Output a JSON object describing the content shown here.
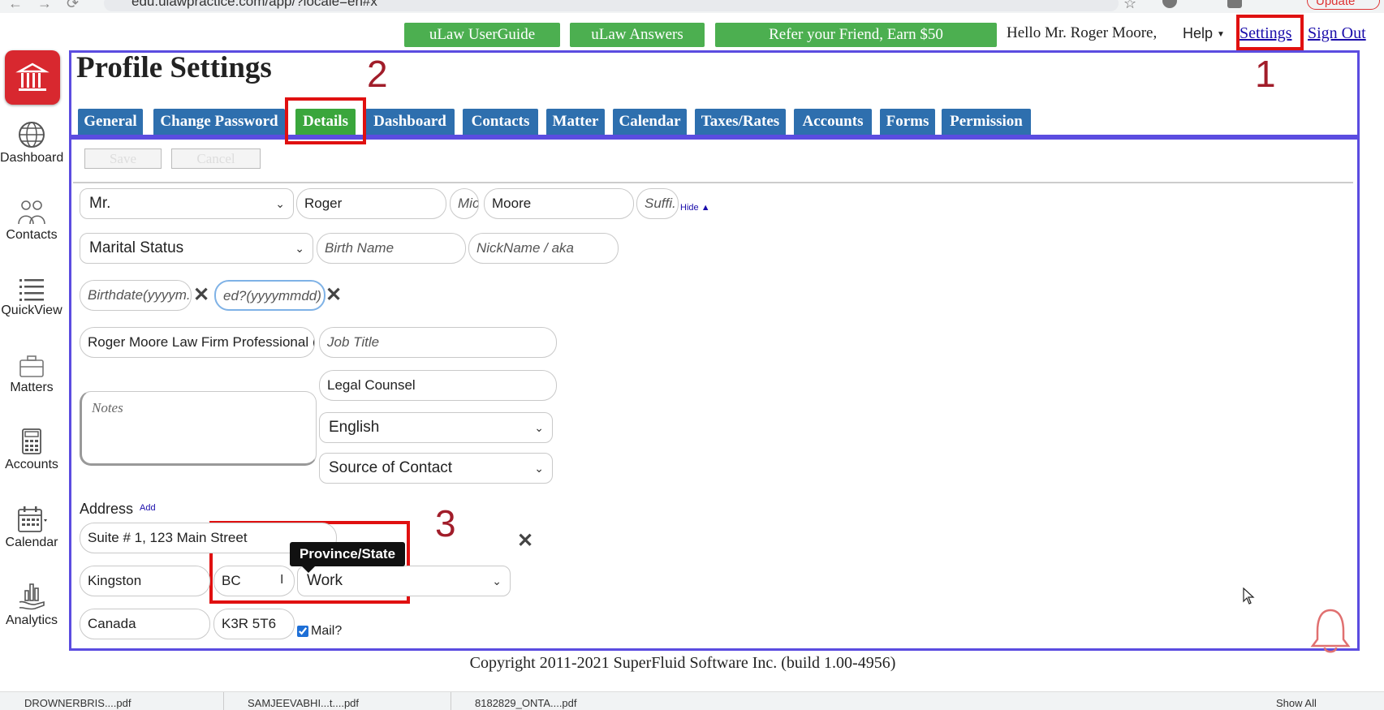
{
  "browser": {
    "url": "edu.ulawpractice.com/app/?locale=en#x",
    "update_label": "Update"
  },
  "topbar": {
    "userguide_label": "uLaw UserGuide",
    "answers_label": "uLaw Answers",
    "refer_label": "Refer your Friend, Earn $50",
    "greeting": "Hello Mr. Roger Moore,",
    "help_label": "Help",
    "settings_label": "Settings",
    "signout_label": "Sign Out"
  },
  "sidebar": {
    "items": [
      {
        "label": "Dashboard",
        "icon": "globe-icon"
      },
      {
        "label": "Contacts",
        "icon": "people-icon"
      },
      {
        "label": "QuickView",
        "icon": "list-icon"
      },
      {
        "label": "Matters",
        "icon": "briefcase-icon"
      },
      {
        "label": "Accounts",
        "icon": "calculator-icon"
      },
      {
        "label": "Calendar",
        "icon": "calendar-icon"
      },
      {
        "label": "Analytics",
        "icon": "analytics-icon"
      }
    ]
  },
  "page": {
    "title": "Profile Settings",
    "tabs": [
      "General",
      "Change Password",
      "Details",
      "Dashboard",
      "Contacts",
      "Matter",
      "Calendar",
      "Taxes/Rates",
      "Accounts",
      "Forms",
      "Permission"
    ],
    "active_tab": "Details",
    "save_label": "Save",
    "cancel_label": "Cancel"
  },
  "annotations": {
    "one": "1",
    "two": "2",
    "three": "3",
    "accent_color": "#e01010",
    "frame_color": "#5b4ce0"
  },
  "form": {
    "salutation": "Mr.",
    "first_name": "Roger",
    "middle_placeholder": "Mic",
    "last_name": "Moore",
    "suffix_placeholder": "Suffi.",
    "hide_label": "Hide",
    "marital_status": "Marital Status",
    "birth_name_placeholder": "Birth Name",
    "nickname_placeholder": "NickName / aka",
    "birthdate_placeholder": "Birthdate(yyyym.",
    "deceased_placeholder": "ed?(yyyymmdd)",
    "company": "Roger Moore Law Firm Professional (",
    "job_title_placeholder": "Job Title",
    "notes_placeholder": "Notes",
    "legal_role": "Legal Counsel",
    "language": "English",
    "source_of_contact": "Source of Contact"
  },
  "address": {
    "label": "Address",
    "add_label": "Add",
    "street": "Suite # 1, 123 Main Street",
    "city": "Kingston",
    "province": "BC",
    "type": "Work",
    "country": "Canada",
    "postal_code": "K3R 5T6",
    "mail_label": "Mail?",
    "mail_checked": true,
    "tooltip": "Province/State"
  },
  "footer": {
    "copyright": "Copyright 2011-2021 SuperFluid Software Inc. (build 1.00-4956)"
  },
  "downloads": {
    "items": [
      "DROWNERBRIS....pdf",
      "SAMJEEVABHI...t....pdf",
      "8182829_ONTA....pdf"
    ],
    "show_all_label": "Show All"
  }
}
